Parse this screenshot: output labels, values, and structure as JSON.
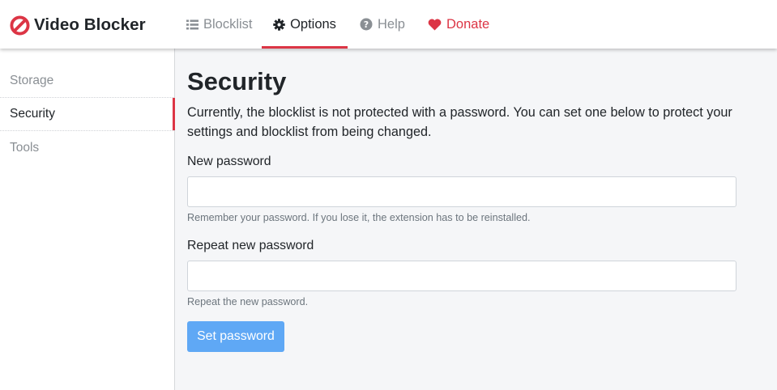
{
  "brand": {
    "name": "Video Blocker",
    "icon": "prohibited-icon",
    "icon_color": "#dc3545"
  },
  "nav": {
    "blocklist": {
      "label": "Blocklist",
      "icon": "list-icon"
    },
    "options": {
      "label": "Options",
      "icon": "gear-icon",
      "active": true
    },
    "help": {
      "label": "Help",
      "icon": "question-circle-icon"
    },
    "donate": {
      "label": "Donate",
      "icon": "heart-icon",
      "color": "#dc3545"
    }
  },
  "sidebar": {
    "items": [
      {
        "label": "Storage",
        "active": false
      },
      {
        "label": "Security",
        "active": true
      },
      {
        "label": "Tools",
        "active": false
      }
    ]
  },
  "main": {
    "title": "Security",
    "description": "Currently, the blocklist is not protected with a password. You can set one below to protect your settings and blocklist from being changed.",
    "new_password": {
      "label": "New password",
      "value": "",
      "hint": "Remember your password. If you lose it, the extension has to be reinstalled."
    },
    "repeat_password": {
      "label": "Repeat new password",
      "value": "",
      "hint": "Repeat the new password."
    },
    "submit_label": "Set password"
  },
  "colors": {
    "accent": "#dc3545",
    "button": "#5fa8f5"
  }
}
